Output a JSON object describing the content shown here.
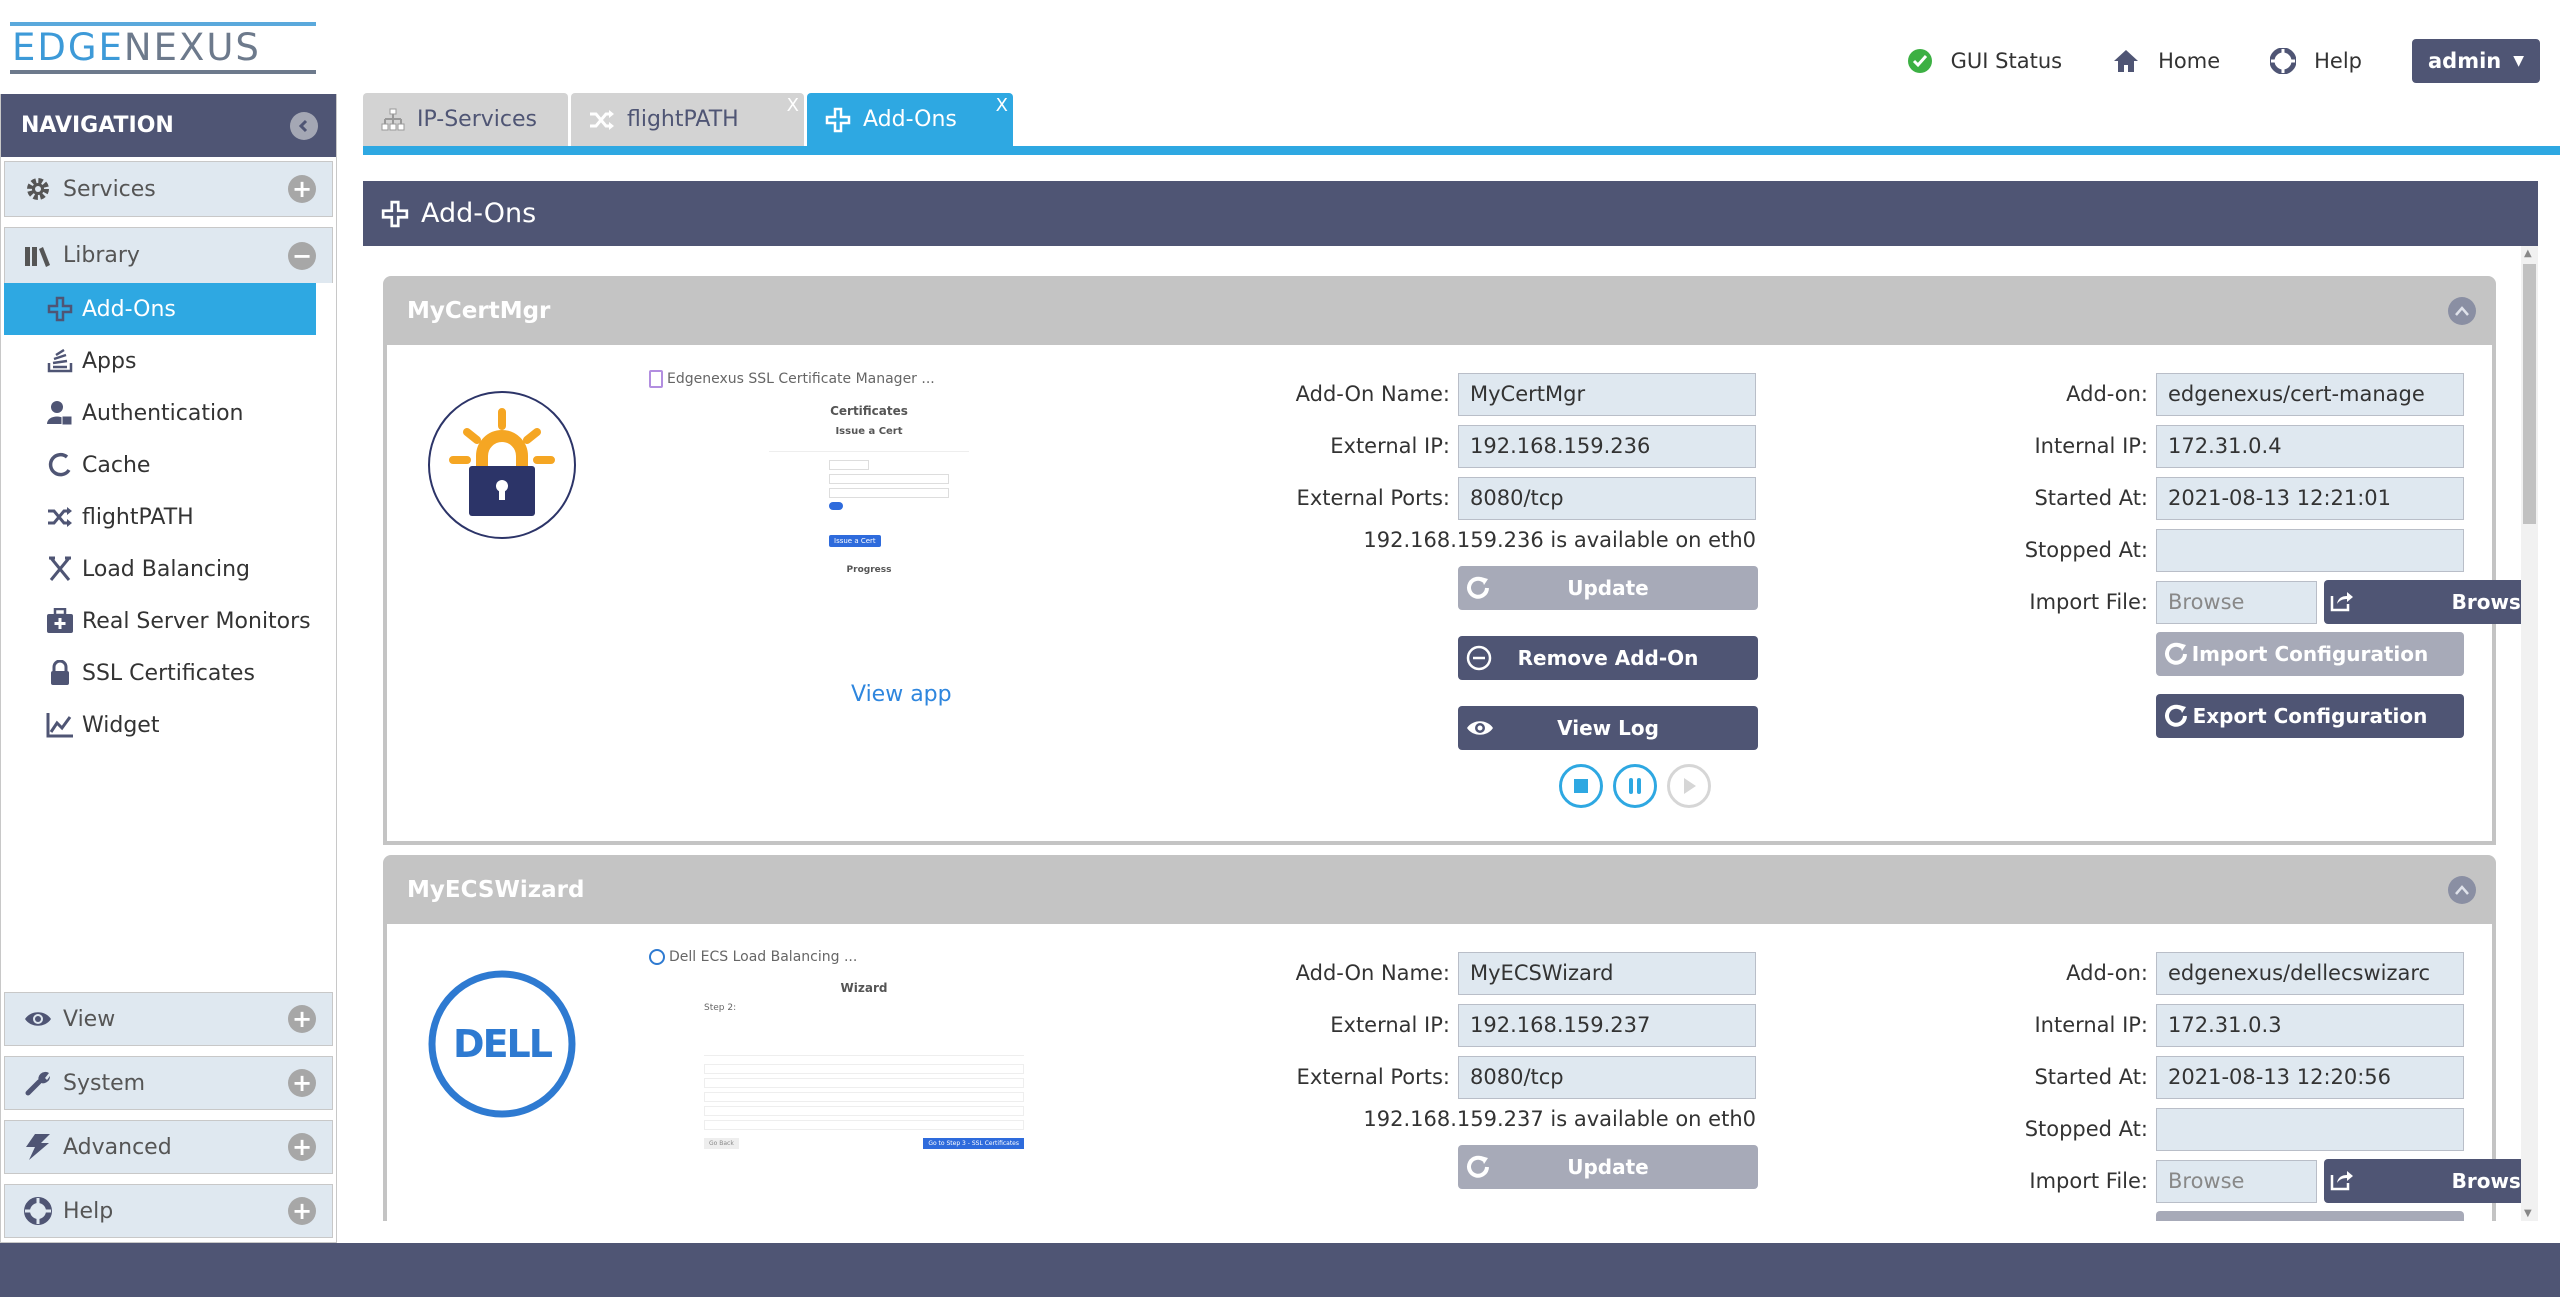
{
  "header": {
    "logo_left": "EDGE",
    "logo_right": "NEXUS",
    "links": [
      {
        "label": "GUI Status",
        "icon": "check-circle-icon"
      },
      {
        "label": "Home",
        "icon": "home-icon"
      },
      {
        "label": "Help",
        "icon": "lifebuoy-icon"
      }
    ],
    "user_menu": {
      "label": "admin",
      "icon": "caret-down-icon"
    }
  },
  "tabs": [
    {
      "label": "IP-Services",
      "icon": "sitemap-icon",
      "closable": false,
      "active": false
    },
    {
      "label": "flightPATH",
      "icon": "shuffle-icon",
      "closable": true,
      "close_label": "X",
      "active": false
    },
    {
      "label": "Add-Ons",
      "icon": "plus-outline-icon",
      "closable": true,
      "close_label": "X",
      "active": true
    }
  ],
  "sidebar": {
    "title": "NAVIGATION",
    "sections": [
      {
        "label": "Services",
        "icon": "gear-icon",
        "expanded": false
      },
      {
        "label": "Library",
        "icon": "library-icon",
        "expanded": true,
        "items": [
          {
            "label": "Add-Ons",
            "icon": "plus-outline-icon",
            "active": true
          },
          {
            "label": "Apps",
            "icon": "apps-stack-icon"
          },
          {
            "label": "Authentication",
            "icon": "user-lock-icon"
          },
          {
            "label": "Cache",
            "icon": "cache-circle-icon"
          },
          {
            "label": "flightPATH",
            "icon": "shuffle-icon"
          },
          {
            "label": "Load Balancing",
            "icon": "load-balancing-icon"
          },
          {
            "label": "Real Server Monitors",
            "icon": "medkit-icon"
          },
          {
            "label": "SSL Certificates",
            "icon": "lock-icon"
          },
          {
            "label": "Widget",
            "icon": "chart-line-icon"
          }
        ]
      },
      {
        "label": "View",
        "icon": "eye-icon",
        "expanded": false
      },
      {
        "label": "System",
        "icon": "wrench-icon",
        "expanded": false
      },
      {
        "label": "Advanced",
        "icon": "bolt-icon",
        "expanded": false
      },
      {
        "label": "Help",
        "icon": "lifebuoy-icon",
        "expanded": false
      }
    ]
  },
  "main": {
    "title": "Add-Ons",
    "labels": {
      "addon_name": "Add-On Name:",
      "external_ip": "External IP:",
      "external_ports": "External Ports:",
      "addon": "Add-on:",
      "internal_ip": "Internal IP:",
      "started_at": "Started At:",
      "stopped_at": "Stopped At:",
      "import_file": "Import File:",
      "browse_placeholder": "Browse",
      "browse_button": "Browse",
      "update": "Update",
      "remove": "Remove Add-On",
      "view_log": "View Log",
      "import_config": "Import Configuration",
      "export_config": "Export Configuration",
      "view_app": "View app"
    },
    "addons": [
      {
        "header": "MyCertMgr",
        "preview_title": "Edgenexus SSL Certificate Manager ...",
        "preview_heading": "Certificates",
        "preview_subheading": "Issue a Cert",
        "preview_button": "Issue a Cert",
        "preview_section": "Progress",
        "addon_name": "MyCertMgr",
        "external_ip": "192.168.159.236",
        "external_ports": "8080/tcp",
        "availability": "192.168.159.236 is available on eth0",
        "addon": "edgenexus/cert-manage",
        "internal_ip": "172.31.0.4",
        "started_at": "2021-08-13 12:21:01",
        "stopped_at": ""
      },
      {
        "header": "MyECSWizard",
        "preview_title": "Dell ECS Load Balancing ...",
        "preview_heading": "Wizard",
        "preview_subheading": "Step 2:",
        "preview_button": "Go to Step 3 - SSL Certificates",
        "preview_back": "Go Back",
        "addon_name": "MyECSWizard",
        "external_ip": "192.168.159.237",
        "external_ports": "8080/tcp",
        "availability": "192.168.159.237 is available on eth0",
        "addon": "edgenexus/dellecswizarc",
        "internal_ip": "172.31.0.3",
        "started_at": "2021-08-13 12:20:56",
        "stopped_at": ""
      }
    ]
  },
  "colors": {
    "brand_navy": "#4f5574",
    "accent_blue": "#2ea8e2",
    "field_bg": "#dfe8f0",
    "card_gray": "#c4c4c4",
    "disabled_btn": "#a7aab8"
  }
}
